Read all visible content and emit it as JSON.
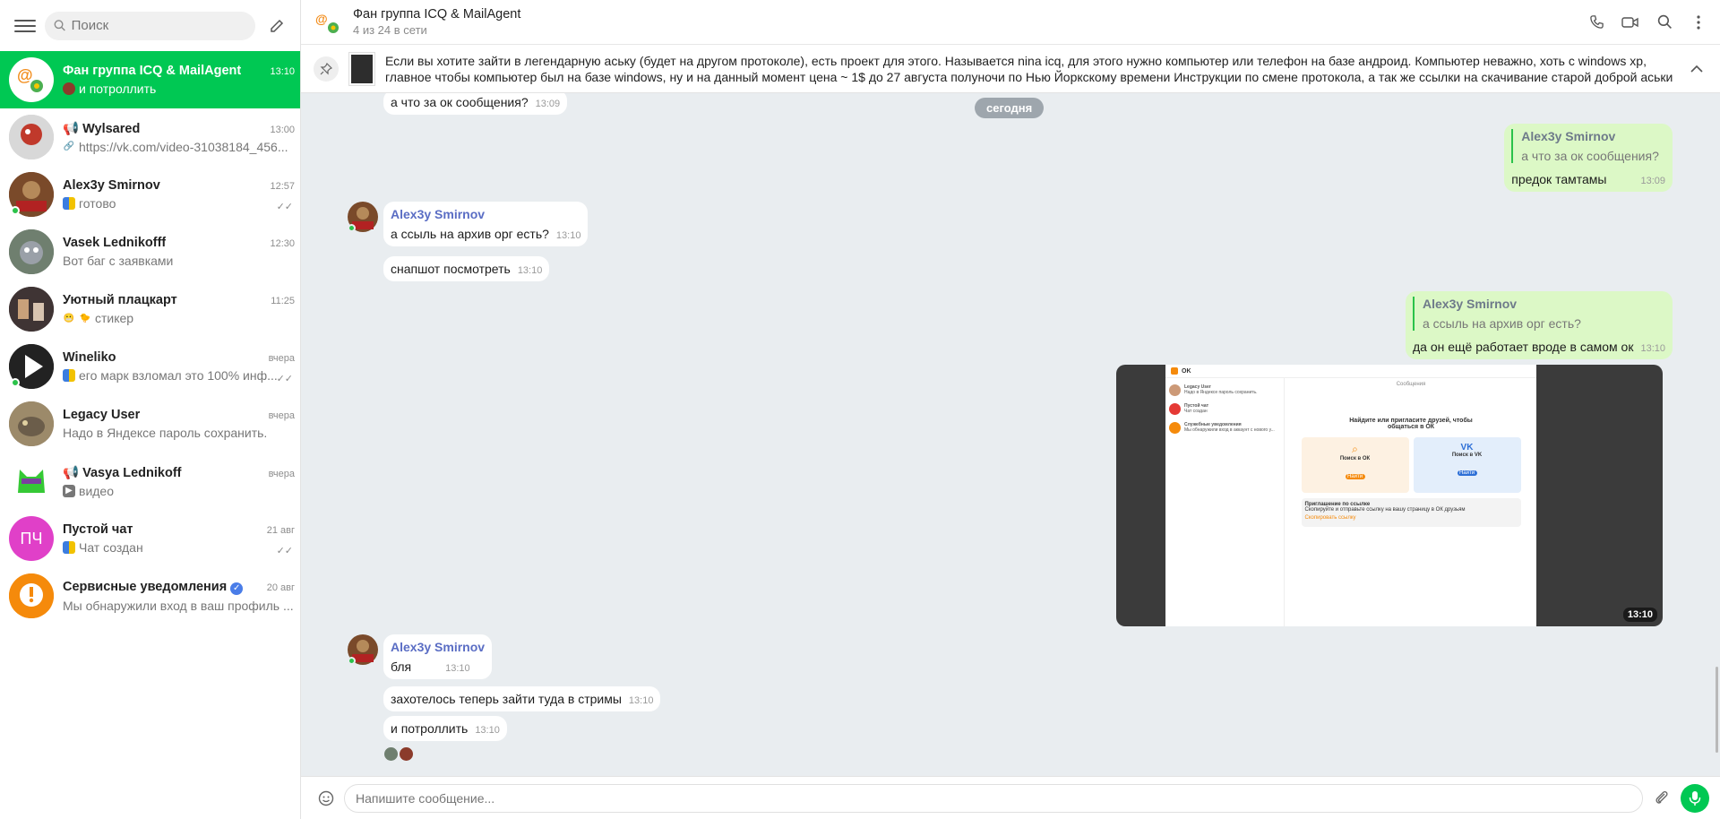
{
  "sidebar": {
    "search_placeholder": "Поиск",
    "chats": [
      {
        "name": "Фан группа ICQ & MailAgent",
        "time": "13:10",
        "message": "и потроллить",
        "active": true
      },
      {
        "name": "Wylsared",
        "time": "13:00",
        "message": "https://vk.com/video-31038184_456..."
      },
      {
        "name": "Alex3y Smirnov",
        "time": "12:57",
        "message": "готово"
      },
      {
        "name": "Vasek Lednikofff",
        "time": "12:30",
        "message": "Вот баг с заявками"
      },
      {
        "name": "Уютный плацкарт",
        "time": "11:25",
        "message": "стикер"
      },
      {
        "name": "Wineliko",
        "time": "вчера",
        "message": "его марк взломал это 100% инф..."
      },
      {
        "name": "Legacy User",
        "time": "вчера",
        "message": "Надо в Яндексе пароль сохранить."
      },
      {
        "name": "Vasya Lednikoff",
        "time": "вчера",
        "message": "видео"
      },
      {
        "name": "Пустой чат",
        "time": "21 авг",
        "message": "Чат создан",
        "initials": "ПЧ"
      },
      {
        "name": "Сервисные уведомления",
        "time": "20 авг",
        "message": "Мы обнаружили вход в ваш профиль ..."
      }
    ]
  },
  "header": {
    "title": "Фан группа ICQ & MailAgent",
    "subtitle": "4 из 24 в сети"
  },
  "pinned": {
    "text": "Если вы хотите зайти в легендарную аську (будет на другом протоколе), есть проект для этого. Называется nina icq, для этого нужно компьютер или телефон на базе андроид. Компьютер неважно, хоть с windows xp, главное чтобы компьютер был на базе windows, ну и на данный момент цена ~ 1$ до 27 августа полуночи по Нью Йоркскому времени Инструкции по смене протокола, а так же ссылки на скачивание старой доброй аськи или..."
  },
  "messages": {
    "m0_text": "а что за ок сообщения?",
    "m0_time": "13:09",
    "date_divider": "сегодня",
    "r1_name": "Alex3y Smirnov",
    "r1_quote": "а что за ок сообщения?",
    "r1_text": "предок тамтамы",
    "r1_time": "13:09",
    "g1_sender": "Alex3y Smirnov",
    "g1_m1": "а ссыль на архив орг есть?",
    "g1_t1": "13:10",
    "g1_m2": "снапшот посмотреть",
    "g1_t2": "13:10",
    "r2_name": "Alex3y Smirnov",
    "r2_quote": "а ссыль на архив орг есть?",
    "r2_text": "да он ещё работает вроде в самом ок",
    "r2_time": "13:10",
    "img_time": "13:10",
    "ss": {
      "logo": "OK",
      "title": "Сообщения",
      "row1_name": "Legacy User",
      "row1_msg": "Надо в Яндексе пароль сохранить.",
      "row2_name": "Пустой чат",
      "row2_msg": "Чат создан",
      "row3_name": "Служебные уведомления",
      "row3_msg": "Мы обнаружили вход в аккаунт с нового у...",
      "headline": "Найдите или пригласите друзей, чтобы общаться в ОК",
      "card1_title": "Поиск в ОК",
      "card1_btn": "Найти",
      "card2_title": "Поиск в VK",
      "card2_btn": "Найти",
      "invite_title": "Приглашение по ссылке",
      "invite_text": "Скопируйте и отправьте ссылку на вашу страницу в ОК друзьям",
      "invite_link": "Скопировать ссылку"
    },
    "g2_sender": "Alex3y Smirnov",
    "g2_m1": "бля",
    "g2_t1": "13:10",
    "g2_m2": "захотелось теперь зайти туда в стримы",
    "g2_t2": "13:10",
    "g2_m3": "и потроллить",
    "g2_t3": "13:10"
  },
  "input": {
    "placeholder": "Напишите сообщение..."
  },
  "colors": {
    "accent": "#00c853",
    "outgoing_bubble": "#dcf8c6",
    "chat_background": "#e9edf0",
    "sender_name": "#5a6dc4"
  }
}
